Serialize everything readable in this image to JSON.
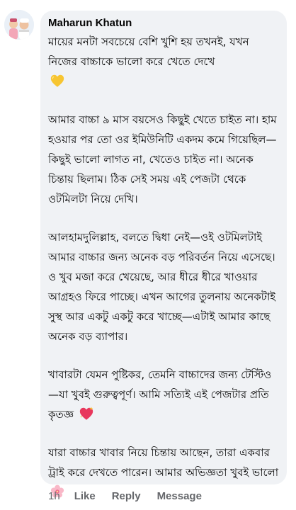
{
  "comment": {
    "author": "Maharun Khatun",
    "paragraphs": [
      "মায়ের মনটা সবচেয়ে বেশি খুশি হয় তখনই, যখন নিজের বাচ্চাকে ভালো করে খেতে দেখে",
      "আমার বাচ্চা ৯ মাস বয়সেও কিছুই খেতে চাইত না। হাম হওয়ার পর তো ওর ইমিউনিটি একদম কমে গিয়েছিল—কিছুই ভালো লাগত না, খেতেও চাইত না। অনেক চিন্তায় ছিলাম। ঠিক সেই সময় এই পেজটা থেকে ওটমিলটা নিয়ে দেখি।",
      "আলহামদুলিল্লাহ, বলতে দ্বিধা নেই—ওই ওটমিলটাই আমার বাচ্চার জন্য অনেক বড় পরিবর্তন নিয়ে এসেছে। ও খুব মজা করে খেয়েছে, আর ধীরে ধীরে খাওয়ার আগ্রহও ফিরে পাচ্ছে। এখন আগের তুলনায় অনেকটাই সুস্থ আর একটু একটু করে খাচ্ছে—এটাই আমার কাছে অনেক বড় ব্যাপার।",
      "খাবারটা যেমন পুষ্টিকর, তেমনি বাচ্চাদের জন্য টেস্টিও—যা খুবই গুরুত্বপূর্ণ। আমি সত্যিই এই পেজটার প্রতি কৃতজ্ঞ",
      "যারা বাচ্চার খাবার নিয়ে চিন্তায় আছেন, তারা একবার ট্রাই করে দেখতে পারেন। আমার অভিজ্ঞতা খুবই ভালো"
    ],
    "emojis": [
      "yellow-heart-emoji",
      "sparkling-heart-emoji",
      "cherry-blossom-emoji"
    ],
    "time": "1h",
    "actions": {
      "like": "Like",
      "reply": "Reply",
      "message": "Message"
    }
  },
  "colors": {
    "bubble_bg": "#f0f2f5",
    "text": "#050505",
    "meta": "#65676b"
  }
}
